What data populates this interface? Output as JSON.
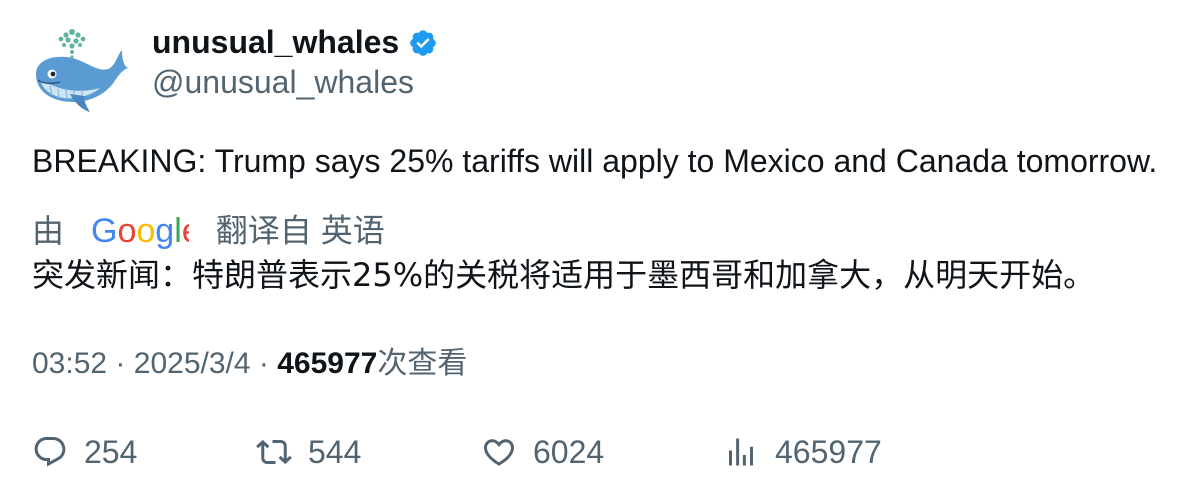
{
  "author": {
    "display_name": "unusual_whales",
    "handle": "@unusual_whales",
    "verified": true,
    "verified_icon": "verified-badge-icon",
    "avatar_icon": "whale-avatar-icon",
    "verified_color": "#1d9bf0"
  },
  "tweet": {
    "text": "BREAKING: Trump says 25% tariffs will apply to Mexico and Canada tomorrow."
  },
  "translation": {
    "by_label": "由",
    "provider_logo": "Google",
    "from_label": "翻译自 英语",
    "text": "突发新闻：特朗普表示25%的关税将适用于墨西哥和加拿大，从明天开始。"
  },
  "meta": {
    "time": "03:52",
    "separator": "·",
    "date": "2025/3/4",
    "views_count": "465977",
    "views_label": "次查看"
  },
  "actions": {
    "reply_count": "254",
    "retweet_count": "544",
    "like_count": "6024",
    "views_count": "465977"
  },
  "colors": {
    "text_primary": "#0f1419",
    "text_secondary": "#536471",
    "google_blue": "#4285f4",
    "google_red": "#ea4335",
    "google_yellow": "#fbbc05",
    "google_green": "#34a853"
  }
}
